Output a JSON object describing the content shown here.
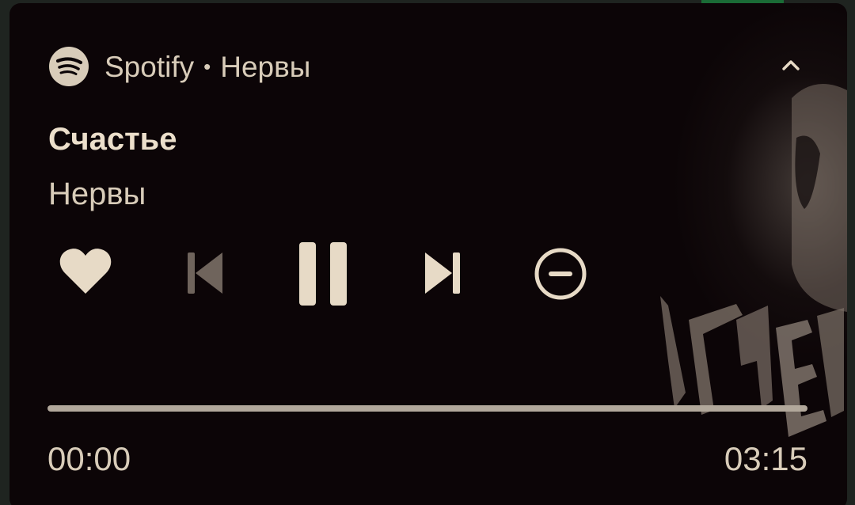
{
  "notification": {
    "app_name": "Spotify",
    "separator": "•",
    "subtitle": "Нервы",
    "app_icon": "spotify-icon",
    "collapse_icon": "chevron-up-icon"
  },
  "track": {
    "title": "Счастье",
    "artist": "Нервы"
  },
  "controls": {
    "like_icon": "heart-icon",
    "previous_icon": "skip-previous-icon",
    "previous_enabled": false,
    "playpause_icon": "pause-icon",
    "next_icon": "skip-next-icon",
    "dismiss_icon": "minus-circle-icon"
  },
  "progress": {
    "elapsed": "00:00",
    "total": "03:15",
    "fraction": 0.0
  },
  "colors": {
    "background": "#0c0507",
    "foreground": "#e7dac6",
    "disabled": "#6f645c",
    "accent_top": "#1a6b36"
  }
}
